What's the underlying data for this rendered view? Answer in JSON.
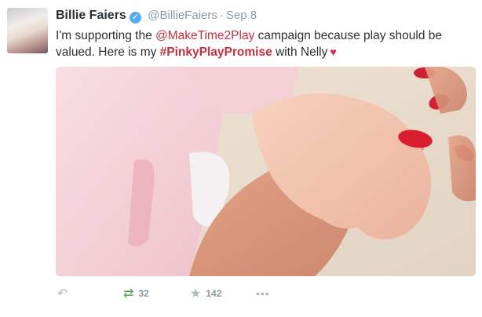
{
  "tweet": {
    "author": {
      "display_name": "Billie Faiers",
      "handle": "@BillieFaiers",
      "verified_icon": "verified-badge-icon"
    },
    "separator": "·",
    "date": "Sep 8",
    "text": {
      "part1": "I'm supporting the ",
      "mention": "@MakeTime2Play",
      "part2": " campaign because play should be valued. Here is my ",
      "hashtag": "#PinkyPlayPromise",
      "part3": " with Nelly",
      "heart": "♥"
    },
    "actions": {
      "reply_icon": "↶",
      "retweet_icon": "⇄",
      "retweet_count": "32",
      "favorite_icon": "★",
      "favorite_count": "142",
      "more_icon": "•••"
    }
  },
  "colors": {
    "link": "#c0303f",
    "muted": "#8899a6",
    "retweet": "#5c9e5c",
    "verified": "#55acee"
  }
}
